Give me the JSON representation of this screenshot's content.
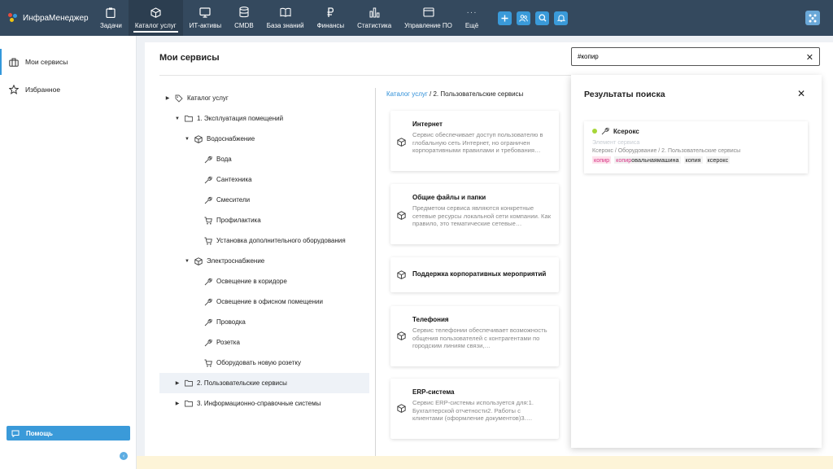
{
  "app": {
    "title": "ИнфраМенеджер"
  },
  "nav": {
    "items": [
      {
        "label": "Задачи",
        "icon": "clipboard-icon"
      },
      {
        "label": "Каталог услуг",
        "icon": "cube-icon"
      },
      {
        "label": "ИТ-активы",
        "icon": "monitor-icon"
      },
      {
        "label": "CMDB",
        "icon": "database-icon"
      },
      {
        "label": "База знаний",
        "icon": "book-icon"
      },
      {
        "label": "Финансы",
        "icon": "ruble-icon"
      },
      {
        "label": "Статистика",
        "icon": "bar-chart-icon"
      },
      {
        "label": "Управление ПО",
        "icon": "window-icon"
      },
      {
        "label": "Ещё",
        "icon": "more-icon"
      }
    ]
  },
  "sidebar": {
    "items": [
      {
        "label": "Мои сервисы"
      },
      {
        "label": "Избранное"
      }
    ],
    "help_label": "Помощь"
  },
  "main": {
    "title": "Мои сервисы",
    "search_value": "#копир"
  },
  "tree": {
    "nodes": [
      {
        "label": "Каталог услуг"
      },
      {
        "label": "1. Эксплуатация помещений"
      },
      {
        "label": "Водоснабжение"
      },
      {
        "label": "Вода"
      },
      {
        "label": "Сантехника"
      },
      {
        "label": "Смесители"
      },
      {
        "label": "Профилактика"
      },
      {
        "label": "Установка дополнительного оборудования"
      },
      {
        "label": "Электроснабжение"
      },
      {
        "label": "Освещение в коридоре"
      },
      {
        "label": "Освещение в офисном помещении"
      },
      {
        "label": "Проводка"
      },
      {
        "label": "Розетка"
      },
      {
        "label": "Оборудовать новую розетку"
      },
      {
        "label": "2. Пользовательские сервисы"
      },
      {
        "label": "3. Информационно-справочные системы"
      }
    ]
  },
  "breadcrumb": {
    "link": "Каталог услуг",
    "separator": " / ",
    "current": "2. Пользовательские сервисы"
  },
  "cards": [
    {
      "title": "Интернет",
      "desc": "Сервис обеспечивает доступ пользователю в глобальную сеть Интернет, но ограничен корпоративными правилами и требования…"
    },
    {
      "title": "Общие файлы и папки",
      "desc": "Предметом сервиса являются конкретные сетевые ресурсы локальной сети компании. Как правило, это тематические сетевые…"
    },
    {
      "title": "Поддержка корпоративных мероприятий",
      "desc": ""
    },
    {
      "title": "Телефония",
      "desc": "Сервис телефонии обеспечивает возможность общения пользователей с контрагентами по городским линиям связи,…"
    },
    {
      "title": "ERP-система",
      "desc": "Сервис ERP-системы используется для:1. Бухгалтерской отчетности2. Работы с клиентами (оформление документов)3.…"
    }
  ],
  "search_results": {
    "title": "Результаты поиска",
    "items": [
      {
        "name": "Ксерокс",
        "subtitle": "Элемент сервиса",
        "path": "Ксерокс / Оборудование / 2. Пользовательские сервисы",
        "tags": [
          {
            "text": "копир",
            "highlight": "копир",
            "rest": ""
          },
          {
            "text": "копировальнаямашина",
            "highlight": "копир",
            "rest": "овальнаямашина"
          },
          {
            "text": "копия",
            "highlight": "",
            "rest": "копия"
          },
          {
            "text": "ксерокс",
            "highlight": "",
            "rest": "ксерокс"
          }
        ]
      }
    ]
  },
  "colors": {
    "topbar": "#34495e",
    "accent": "#3a9ad9",
    "status_dot": "#a6d638",
    "highlight": "#d63384"
  }
}
